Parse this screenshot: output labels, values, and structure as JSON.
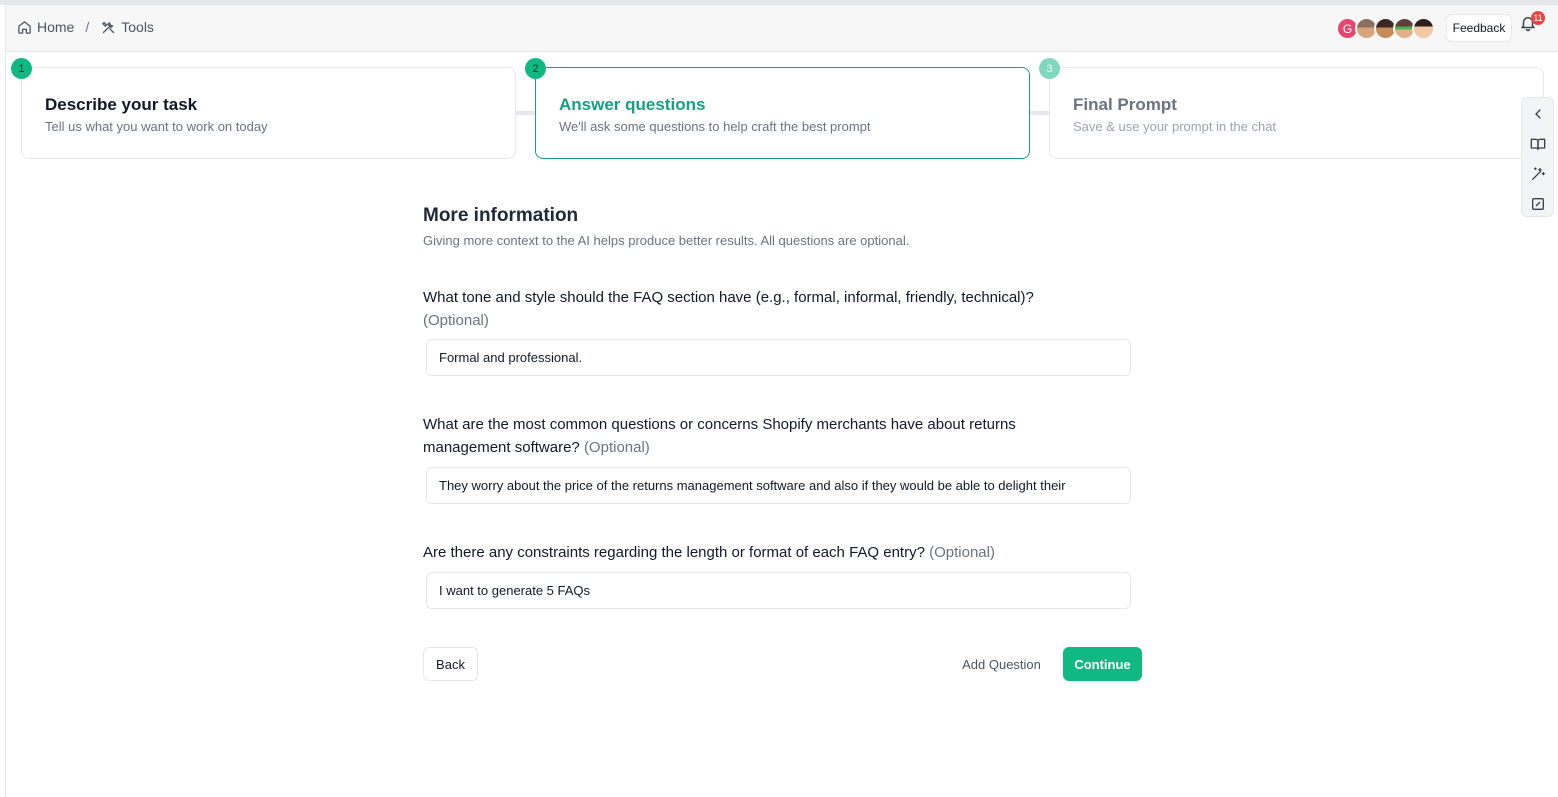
{
  "header": {
    "breadcrumbs": [
      {
        "label": "Home",
        "icon": "home-icon"
      },
      {
        "label": "Tools",
        "icon": "tools-icon"
      }
    ],
    "separator": "/",
    "avatar_initial": "G",
    "feedback_label": "Feedback",
    "notification_count": "11"
  },
  "steps": [
    {
      "number": "1",
      "title": "Describe your task",
      "subtitle": "Tell us what you want to work on today",
      "state": "completed"
    },
    {
      "number": "2",
      "title": "Answer questions",
      "subtitle": "We'll ask some questions to help craft the best prompt",
      "state": "active"
    },
    {
      "number": "3",
      "title": "Final Prompt",
      "subtitle": "Save & use your prompt in the chat",
      "state": "upcoming"
    }
  ],
  "side_rail": {
    "icons": [
      "chevron-left-icon",
      "book-icon",
      "magic-wand-icon",
      "edit-square-icon"
    ]
  },
  "main": {
    "title": "More information",
    "subtitle": "Giving more context to the AI helps produce better results. All questions are optional.",
    "optional_label": "(Optional)",
    "questions": [
      {
        "text": "What tone and style should the FAQ section have (e.g., formal, informal, friendly, technical)?",
        "value": "Formal and professional."
      },
      {
        "text": "What are the most common questions or concerns Shopify merchants have about returns management software?",
        "value": "They worry about the price of the returns management software and also if they would be able to delight their"
      },
      {
        "text": "Are there any constraints regarding the length or format of each FAQ entry?",
        "value": "I want to generate 5 FAQs"
      }
    ],
    "back_label": "Back",
    "add_question_label": "Add Question",
    "continue_label": "Continue"
  },
  "colors": {
    "accent": "#10b981",
    "accent_dark": "#16a085",
    "badge": "#ef4444"
  }
}
